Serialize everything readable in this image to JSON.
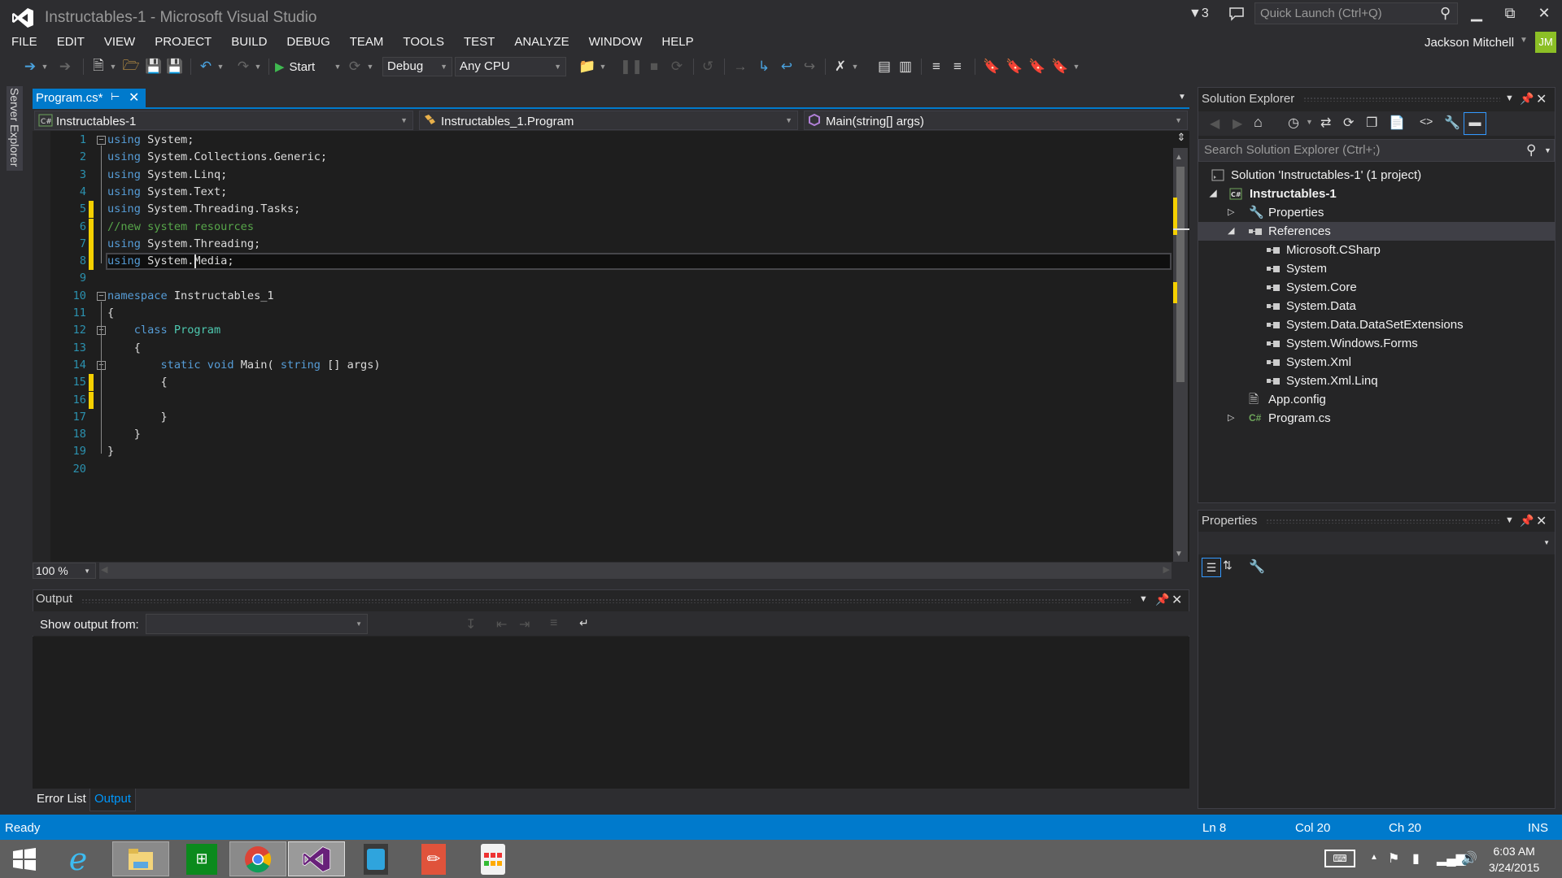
{
  "window": {
    "title": "Instructables-1 - Microsoft Visual Studio",
    "notification_count": "3",
    "quick_launch_placeholder": "Quick Launch (Ctrl+Q)",
    "user_name": "Jackson Mitchell",
    "user_initials": "JM",
    "accent_color": "#007acc",
    "avatar_color": "#8cbf26"
  },
  "menu": [
    "FILE",
    "EDIT",
    "VIEW",
    "PROJECT",
    "BUILD",
    "DEBUG",
    "TEAM",
    "TOOLS",
    "TEST",
    "ANALYZE",
    "WINDOW",
    "HELP"
  ],
  "toolbar": {
    "start_label": "Start",
    "configuration": "Debug",
    "platform": "Any CPU"
  },
  "left_strip": {
    "server_explorer": "Server Explorer"
  },
  "document": {
    "tab_label": "Program.cs*",
    "nav_project": "Instructables-1",
    "nav_class": "Instructables_1.Program",
    "nav_member": "Main(string[] args)",
    "zoom": "100 %",
    "lines": [
      {
        "n": "1",
        "tokens": [
          [
            "kw",
            "using"
          ],
          [
            "",
            "System;"
          ]
        ]
      },
      {
        "n": "2",
        "tokens": [
          [
            "kw",
            "using"
          ],
          [
            "",
            "System.Collections.Generic;"
          ]
        ]
      },
      {
        "n": "3",
        "tokens": [
          [
            "kw",
            "using"
          ],
          [
            "",
            "System.Linq;"
          ]
        ]
      },
      {
        "n": "4",
        "tokens": [
          [
            "kw",
            "using"
          ],
          [
            "",
            "System.Text;"
          ]
        ]
      },
      {
        "n": "5",
        "tokens": [
          [
            "kw",
            "using"
          ],
          [
            "",
            "System.Threading.Tasks;"
          ]
        ]
      },
      {
        "n": "6",
        "tokens": [
          [
            "cm",
            "//new system resources"
          ]
        ]
      },
      {
        "n": "7",
        "tokens": [
          [
            "kw",
            "using"
          ],
          [
            "",
            "System.Threading;"
          ]
        ]
      },
      {
        "n": "8",
        "tokens": [
          [
            "kw",
            "using"
          ],
          [
            "",
            "System.Media;"
          ]
        ]
      },
      {
        "n": "9",
        "tokens": []
      },
      {
        "n": "10",
        "tokens": [
          [
            "kw",
            "namespace"
          ],
          [
            "",
            "Instructables_1"
          ]
        ]
      },
      {
        "n": "11",
        "tokens": [
          [
            "",
            "{"
          ]
        ]
      },
      {
        "n": "12",
        "tokens": [
          [
            "",
            "    "
          ],
          [
            "kw",
            "class"
          ],
          [
            "ty",
            "Program"
          ]
        ]
      },
      {
        "n": "13",
        "tokens": [
          [
            "",
            "    {"
          ]
        ]
      },
      {
        "n": "14",
        "tokens": [
          [
            "",
            "        "
          ],
          [
            "kw",
            "static"
          ],
          [
            "kw",
            "void"
          ],
          [
            "",
            "Main("
          ],
          [
            "kw",
            "string"
          ],
          [
            "",
            "[] args)"
          ]
        ]
      },
      {
        "n": "15",
        "tokens": [
          [
            "",
            "        {"
          ]
        ]
      },
      {
        "n": "16",
        "tokens": []
      },
      {
        "n": "17",
        "tokens": [
          [
            "",
            "        }"
          ]
        ]
      },
      {
        "n": "18",
        "tokens": [
          [
            "",
            "    }"
          ]
        ]
      },
      {
        "n": "19",
        "tokens": [
          [
            "",
            "}"
          ]
        ]
      },
      {
        "n": "20",
        "tokens": []
      }
    ],
    "changed_lines": [
      5,
      6,
      7,
      8,
      15,
      16
    ],
    "current_line": 8
  },
  "output": {
    "title": "Output",
    "show_output_from_label": "Show output from:",
    "show_output_from_value": ""
  },
  "bottom_tabs": {
    "error_list": "Error List",
    "output": "Output"
  },
  "solution_explorer": {
    "title": "Solution Explorer",
    "search_placeholder": "Search Solution Explorer (Ctrl+;)",
    "solution": "Solution 'Instructables-1' (1 project)",
    "project": "Instructables-1",
    "properties": "Properties",
    "references": "References",
    "reference_items": [
      "Microsoft.CSharp",
      "System",
      "System.Core",
      "System.Data",
      "System.Data.DataSetExtensions",
      "System.Windows.Forms",
      "System.Xml",
      "System.Xml.Linq"
    ],
    "app_config": "App.config",
    "program_cs": "Program.cs"
  },
  "properties_panel": {
    "title": "Properties"
  },
  "status": {
    "state": "Ready",
    "line": "Ln 8",
    "col": "Col 20",
    "ch": "Ch 20",
    "mode": "INS"
  },
  "taskbar": {
    "apps": [
      "windows-start",
      "internet-explorer",
      "file-explorer",
      "windows-store",
      "chrome",
      "visual-studio",
      "tinkercad",
      "autodesk-sketchbook",
      "apps-grid"
    ],
    "time": "6:03 AM",
    "date": "3/24/2015"
  }
}
